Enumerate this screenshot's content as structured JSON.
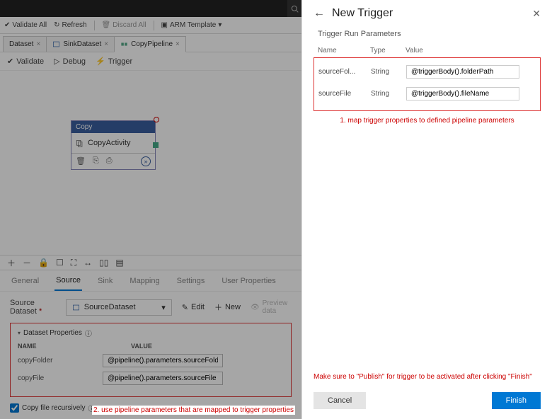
{
  "toolbar": {
    "validate_all": "Validate All",
    "refresh": "Refresh",
    "discard_all": "Discard All",
    "arm_template": "ARM Template"
  },
  "tabs": [
    {
      "label": "Dataset"
    },
    {
      "label": "SinkDataset"
    },
    {
      "label": "CopyPipeline"
    }
  ],
  "canvas_toolbar": {
    "validate": "Validate",
    "debug": "Debug",
    "trigger": "Trigger"
  },
  "activity": {
    "header": "Copy",
    "name": "CopyActivity"
  },
  "bottom_tabs": {
    "general": "General",
    "source": "Source",
    "sink": "Sink",
    "mapping": "Mapping",
    "settings": "Settings",
    "user_props": "User Properties"
  },
  "source": {
    "label": "Source Dataset",
    "value": "SourceDataset",
    "edit": "Edit",
    "new": "New",
    "preview": "Preview data"
  },
  "dataset_props": {
    "heading": "Dataset Properties",
    "col_name": "NAME",
    "col_value": "VALUE",
    "rows": [
      {
        "name": "copyFolder",
        "value": "@pipeline().parameters.sourceFolder"
      },
      {
        "name": "copyFile",
        "value": "@pipeline().parameters.sourceFile"
      }
    ]
  },
  "recursive_label": "Copy file recursively",
  "annotation2": "2. use pipeline parameters that are mapped to trigger properties",
  "side": {
    "title": "New Trigger",
    "subtitle": "Trigger Run Parameters",
    "cols": {
      "name": "Name",
      "type": "Type",
      "value": "Value"
    },
    "params": [
      {
        "name": "sourceFol...",
        "type": "String",
        "value": "@triggerBody().folderPath"
      },
      {
        "name": "sourceFile",
        "type": "String",
        "value": "@triggerBody().fileName"
      }
    ],
    "annotation1": "1. map trigger properties to defined pipeline parameters",
    "note": "Make sure to \"Publish\" for trigger to be activated after clicking \"Finish\"",
    "cancel": "Cancel",
    "finish": "Finish"
  }
}
